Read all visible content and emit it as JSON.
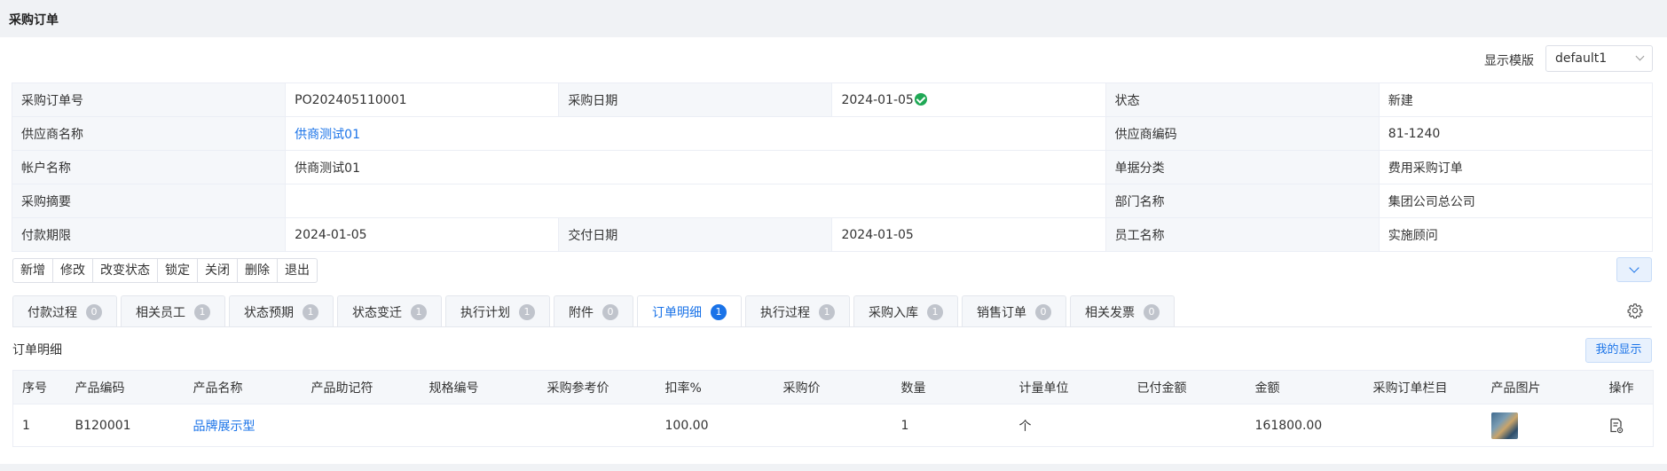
{
  "page": {
    "title": "采购订单"
  },
  "template": {
    "label": "显示模版",
    "value": "default1"
  },
  "info": {
    "rows": [
      [
        {
          "label": "采购订单号",
          "value": "PO202405110001"
        },
        {
          "label": "采购日期",
          "value": "2024-01-05"
        },
        {
          "label": "状态",
          "value": "新建"
        }
      ],
      [
        {
          "label": "供应商名称",
          "value": "供商测试01"
        },
        {
          "label": "供应商编码",
          "value": "81-1240"
        }
      ],
      [
        {
          "label": "帐户名称",
          "value": "供商测试01"
        },
        {
          "label": "单据分类",
          "value": "费用采购订单"
        }
      ],
      [
        {
          "label": "采购摘要",
          "value": ""
        },
        {
          "label": "部门名称",
          "value": "集团公司总公司"
        }
      ],
      [
        {
          "label": "付款期限",
          "value": "2024-01-05"
        },
        {
          "label": "交付日期",
          "value": "2024-01-05"
        },
        {
          "label": "员工名称",
          "value": "实施顾问"
        }
      ]
    ]
  },
  "toolbar": [
    "新增",
    "修改",
    "改变状态",
    "锁定",
    "关闭",
    "删除",
    "退出"
  ],
  "tabs": [
    {
      "label": "付款过程",
      "count": "0"
    },
    {
      "label": "相关员工",
      "count": "1"
    },
    {
      "label": "状态预期",
      "count": "1"
    },
    {
      "label": "状态变迁",
      "count": "1"
    },
    {
      "label": "执行计划",
      "count": "1"
    },
    {
      "label": "附件",
      "count": "0"
    },
    {
      "label": "订单明细",
      "count": "1",
      "active": true
    },
    {
      "label": "执行过程",
      "count": "1"
    },
    {
      "label": "采购入库",
      "count": "1"
    },
    {
      "label": "销售订单",
      "count": "0"
    },
    {
      "label": "相关发票",
      "count": "0"
    }
  ],
  "detail": {
    "section_label": "订单明细",
    "my_display_button": "我的显示",
    "columns": [
      "序号",
      "产品编码",
      "产品名称",
      "产品助记符",
      "规格编号",
      "采购参考价",
      "扣率%",
      "采购价",
      "数量",
      "计量单位",
      "已付金额",
      "金额",
      "采购订单栏目",
      "产品图片",
      "操作"
    ],
    "rows": [
      {
        "seq": "1",
        "code": "B120001",
        "name": "品牌展示型",
        "mnemonic": "",
        "spec": "",
        "ref_price": "",
        "discount": "100.00",
        "price": "",
        "qty": "1",
        "unit": "个",
        "paid": "",
        "amount": "161800.00",
        "column": ""
      }
    ]
  },
  "icons": {
    "status_check": "check-circle-icon",
    "settings": "gear-icon",
    "collapse": "chevron-down-icon",
    "row_action": "document-settings-icon"
  },
  "colors": {
    "accent": "#1a73e8",
    "success": "#1fa855"
  }
}
